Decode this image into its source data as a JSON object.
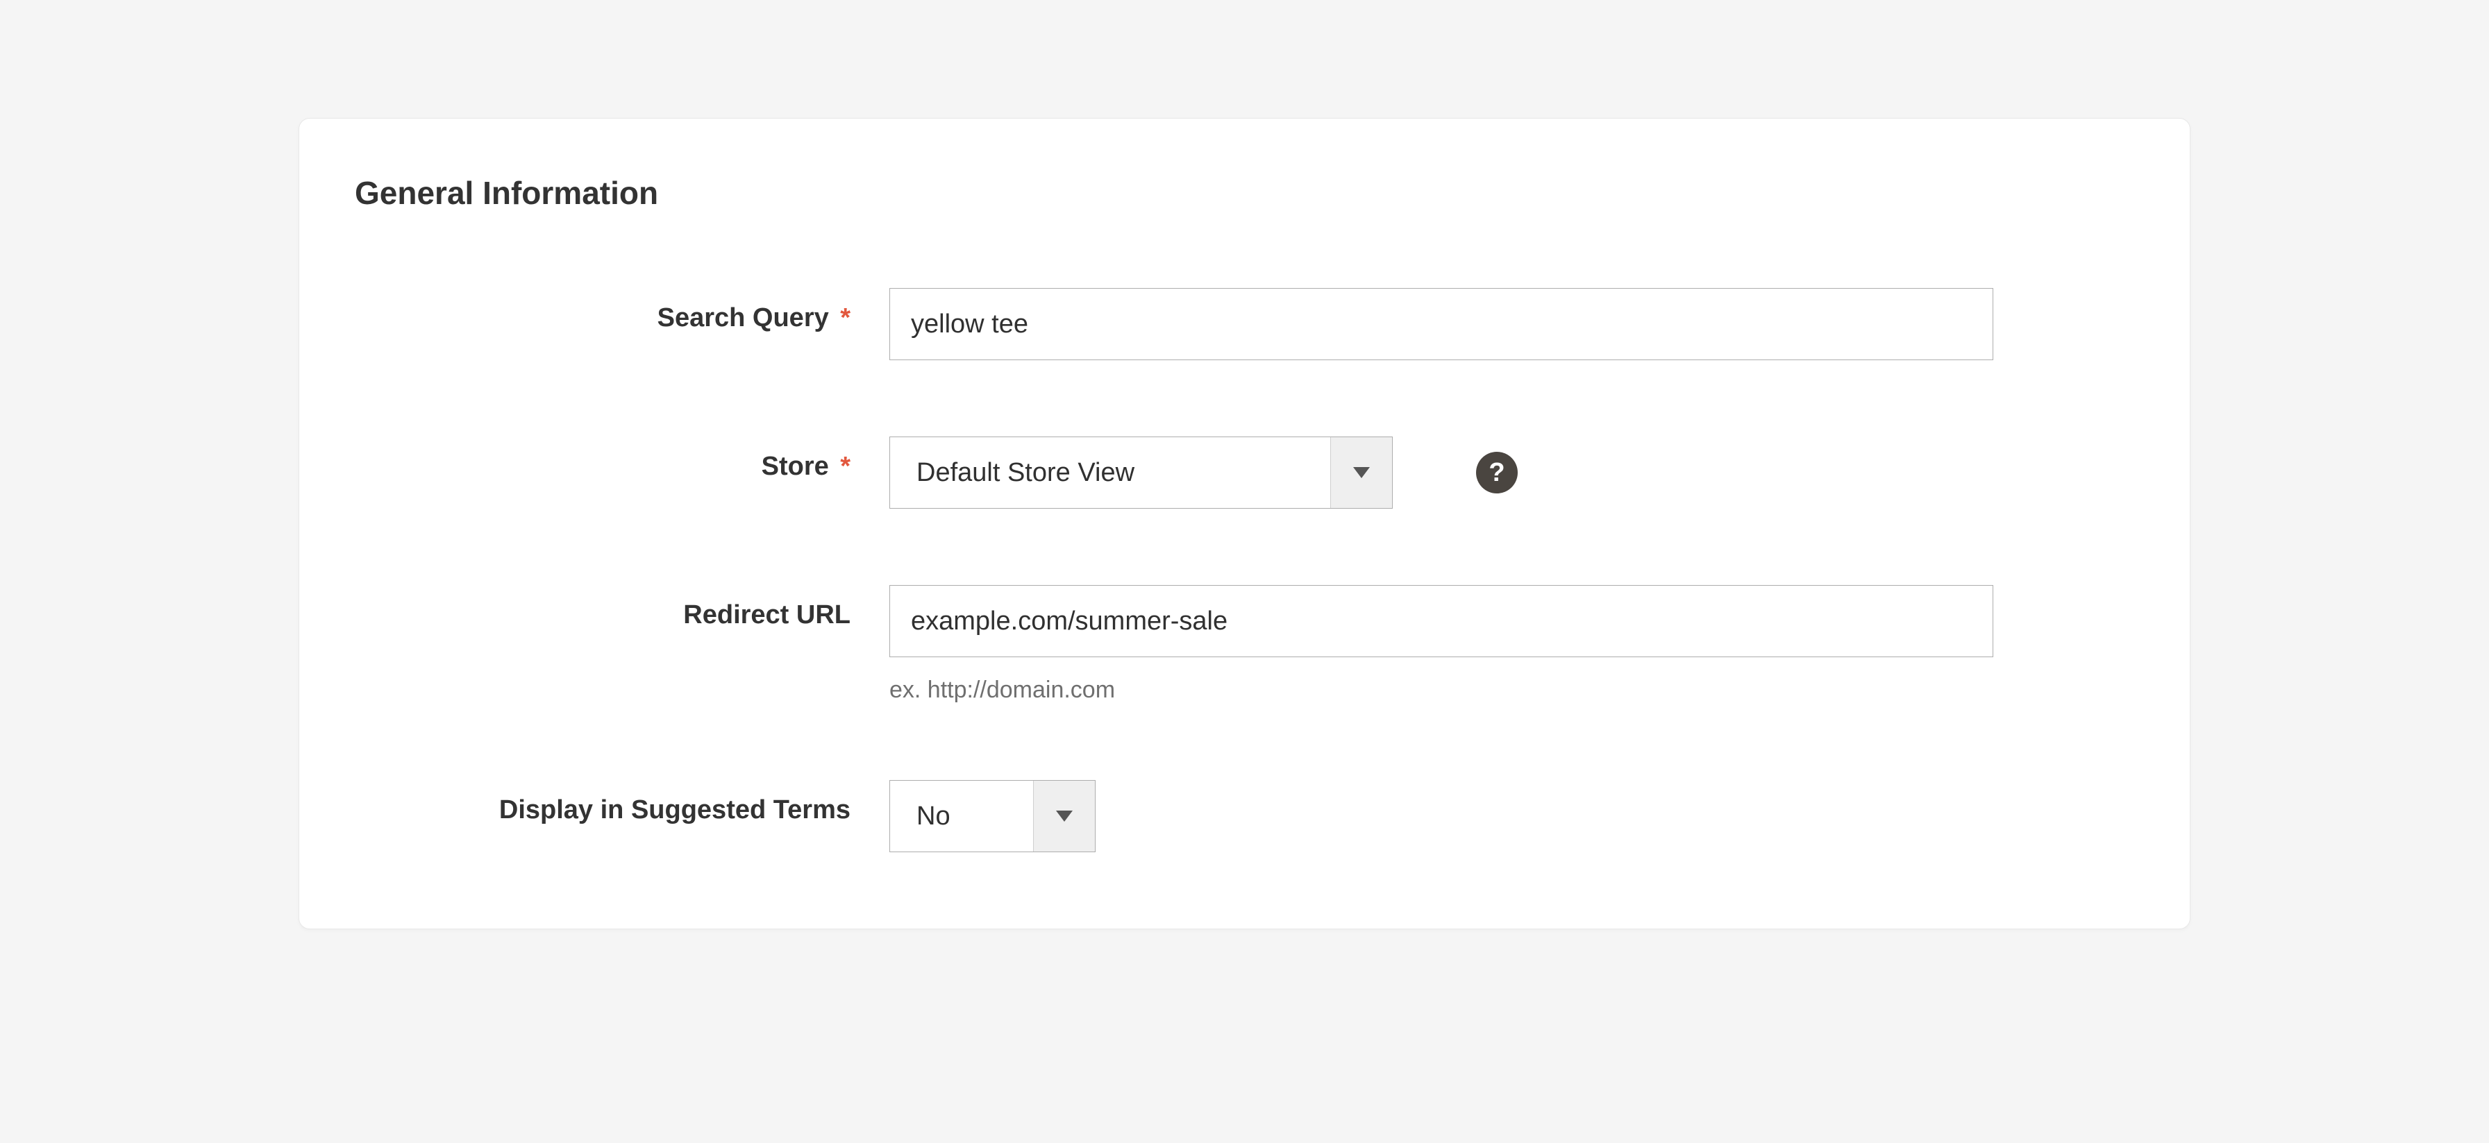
{
  "panel": {
    "title": "General Information"
  },
  "fields": {
    "search_query": {
      "label": "Search Query",
      "required_mark": "*",
      "value": "yellow tee"
    },
    "store": {
      "label": "Store",
      "required_mark": "*",
      "value": "Default Store View",
      "help_glyph": "?"
    },
    "redirect_url": {
      "label": "Redirect URL",
      "value": "example.com/summer-sale",
      "hint": "ex. http://domain.com"
    },
    "display_in_suggested": {
      "label": "Display in Suggested Terms",
      "value": "No"
    }
  }
}
